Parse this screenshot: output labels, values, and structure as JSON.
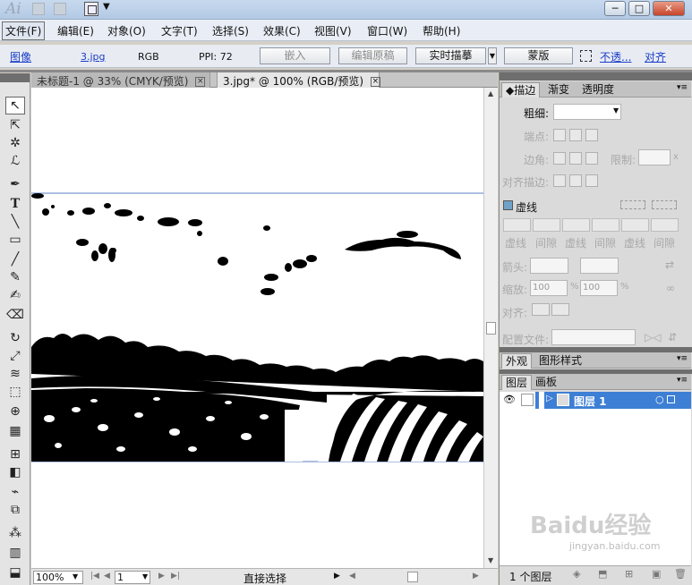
{
  "app": {
    "logo": "Ai"
  },
  "menubar": {
    "items": [
      "文件(F)",
      "编辑(E)",
      "对象(O)",
      "文字(T)",
      "选择(S)",
      "效果(C)",
      "视图(V)",
      "窗口(W)",
      "帮助(H)"
    ]
  },
  "controlbar": {
    "image_label": "图像",
    "filename": "3.jpg",
    "color_mode": "RGB",
    "ppi": "PPI: 72",
    "embed_button": "嵌入",
    "edit_original_button": "编辑原稿",
    "live_trace_button": "实时描摹",
    "mask_button": "蒙版",
    "opacity_link": "不透...",
    "align_link": "对齐"
  },
  "tabs": [
    {
      "label": "未标题-1 @ 33% (CMYK/预览)",
      "close": "×"
    },
    {
      "label": "3.jpg* @ 100% (RGB/预览)",
      "close": "×"
    }
  ],
  "statusbar": {
    "zoom": "100%",
    "page": "1",
    "tool_label": "直接选择"
  },
  "stroke_panel": {
    "tabs": [
      "描边",
      "渐变",
      "透明度"
    ],
    "weight_label": "粗细:",
    "cap_label": "端点:",
    "corner_label": "边角:",
    "limit_label": "限制:",
    "limit_unit": "x",
    "align_label": "对齐描边:",
    "dashed_label": "虚线",
    "dash_labels": [
      "虚线",
      "间隙",
      "虚线",
      "间隙",
      "虚线",
      "间隙"
    ],
    "arrow_label": "箭头:",
    "scale_label": "缩放:",
    "scale_start": "100",
    "scale_end": "100",
    "scale_unit": "%",
    "align_arrow_label": "对齐:",
    "profile_label": "配置文件:"
  },
  "appearance_panel": {
    "tabs": [
      "外观",
      "图形样式"
    ]
  },
  "layers_panel": {
    "tabs": [
      "图层",
      "画板"
    ],
    "layer_name": "图层 1",
    "footer": "1 个图层"
  },
  "watermark": {
    "brand": "Baidu经验",
    "url": "jingyan.baidu.com"
  }
}
